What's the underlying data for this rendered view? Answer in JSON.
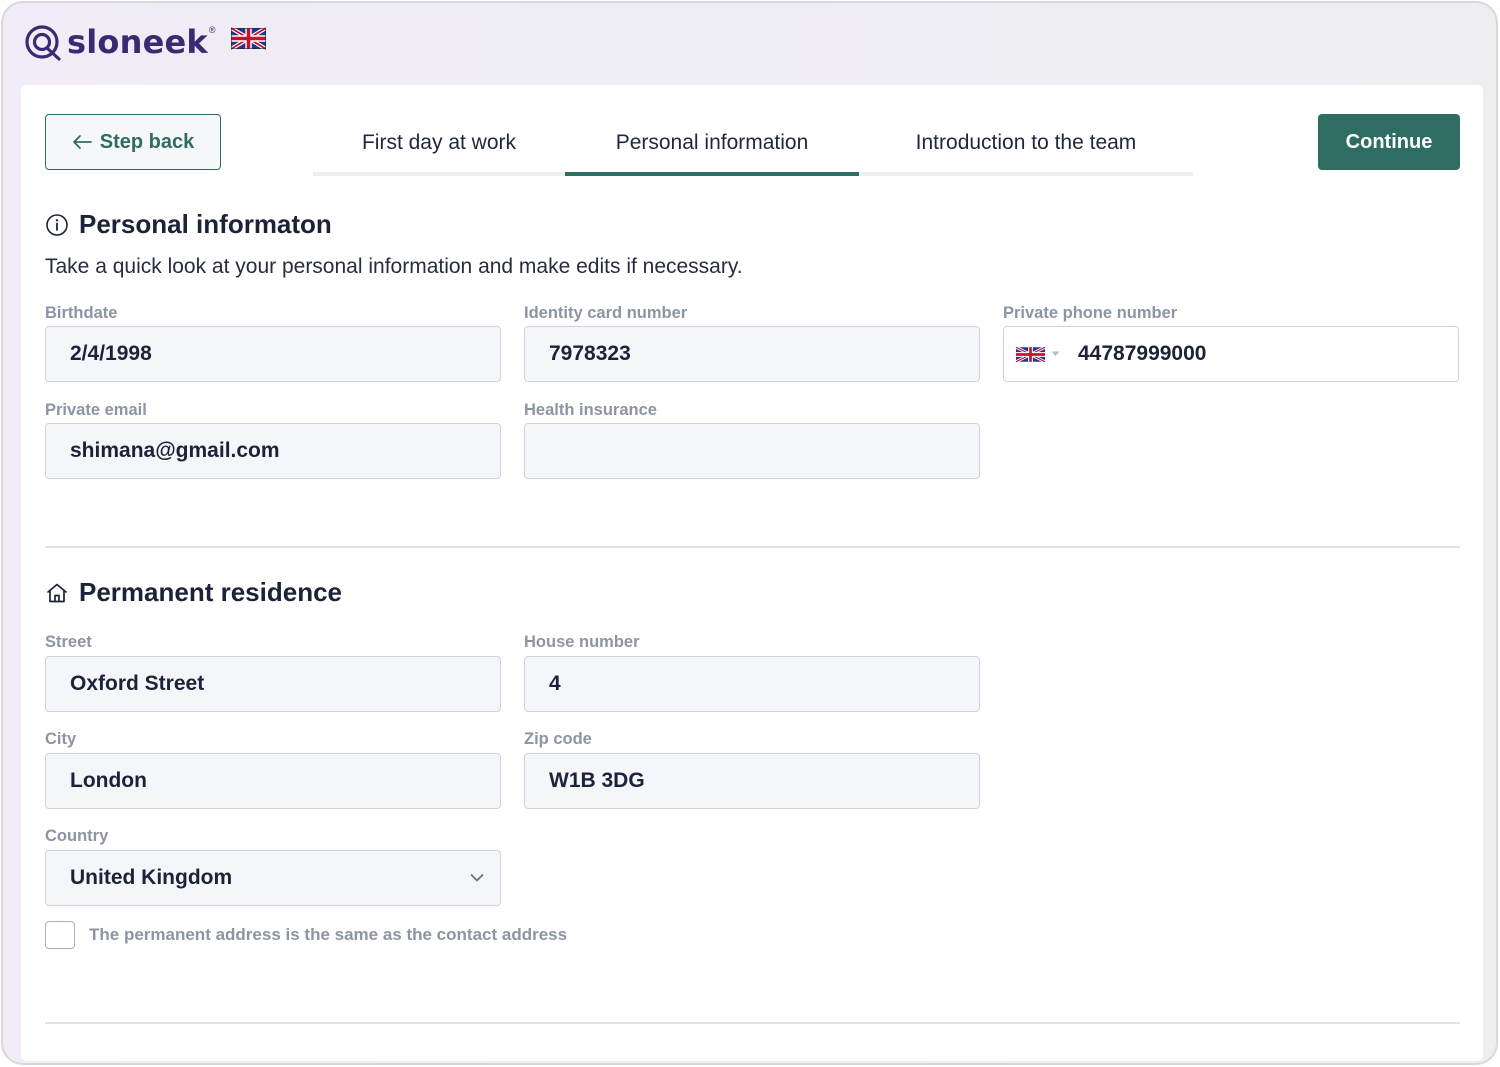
{
  "app": {
    "logo_text": "sloneek",
    "logo_reg": "®",
    "language_flag": "uk-flag-icon"
  },
  "nav": {
    "step_back_label": "Step back",
    "continue_label": "Continue",
    "tabs": [
      {
        "label": "First day at work",
        "active": false
      },
      {
        "label": "Personal information",
        "active": true
      },
      {
        "label": "Introduction to the team",
        "active": false
      }
    ]
  },
  "personal": {
    "title": "Personal informaton",
    "subtitle": "Take a quick look at your personal information and make edits if necessary.",
    "birthdate": {
      "label": "Birthdate",
      "value": "2/4/1998"
    },
    "id_card": {
      "label": "Identity card number",
      "value": "7978323"
    },
    "phone": {
      "label": "Private phone number",
      "value": "44787999000",
      "country_flag": "uk-flag-icon"
    },
    "email": {
      "label": "Private email",
      "value": "shimana@gmail.com"
    },
    "health_insurance": {
      "label": "Health insurance",
      "value": ""
    }
  },
  "residence": {
    "title": "Permanent residence",
    "street": {
      "label": "Street",
      "value": "Oxford Street"
    },
    "house_number": {
      "label": "House number",
      "value": "4"
    },
    "city": {
      "label": "City",
      "value": "London"
    },
    "zip": {
      "label": "Zip code",
      "value": "W1B 3DG"
    },
    "country": {
      "label": "Country",
      "value": "United Kingdom"
    },
    "same_address": {
      "label": "The permanent address is the same as the contact address",
      "checked": false
    }
  },
  "colors": {
    "accent": "#2f6d62",
    "brand": "#3a2a72",
    "label": "#8d94a3",
    "field_bg": "#f4f6f9"
  }
}
